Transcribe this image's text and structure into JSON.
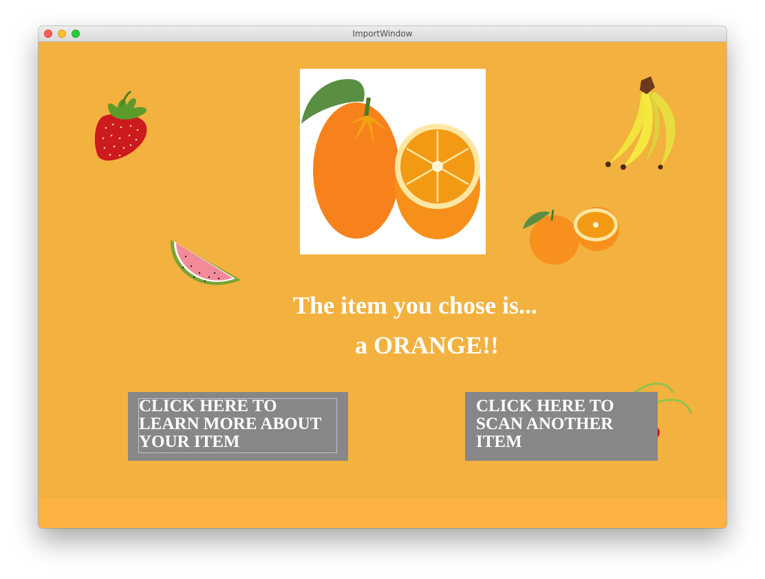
{
  "window": {
    "title": "ImportWindow"
  },
  "main": {
    "headline": "The item you chose is...",
    "result": "a ORANGE!!",
    "image_icon": "orange-fruit-icon"
  },
  "buttons": {
    "learn_more_label": "CLICK HERE TO\nLEARN MORE ABOUT\nYOUR ITEM",
    "scan_another_label": "CLICK HERE TO\nSCAN ANOTHER\nITEM"
  },
  "decorations": [
    "strawberry-icon",
    "watermelon-icon",
    "banana-icon",
    "orange-icon",
    "cherry-icon"
  ],
  "colors": {
    "background": "#f3b13f",
    "footer_band": "#fdb341",
    "button": "#878787",
    "text": "#ffffff"
  }
}
